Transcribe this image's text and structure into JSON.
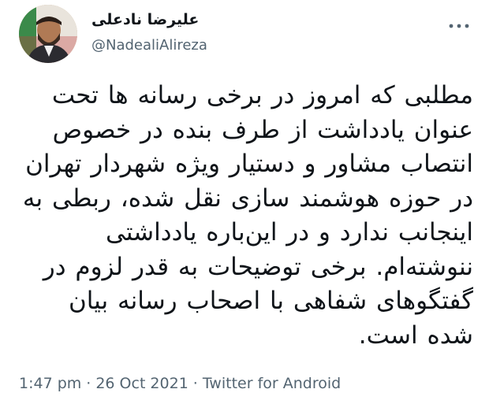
{
  "author": {
    "display_name": "علیرضا نادعلی",
    "handle": "@NadealiAlireza",
    "avatar_icon": "profile-photo"
  },
  "more_icon": "ellipsis-icon",
  "tweet": {
    "text": "مطلبی که امروز در برخی رسانه ها تحت عنوان یادداشت از طرف بنده در خصوص انتصاب مشاور و دستیار ویژه شهردار تهران در حوزه هوشمند سازی نقل شده، ربطی به اینجانب ندارد و در این‌باره یادداشتی ننوشته‌ام. برخی توضیحات به قدر لزوم در گفتگوهای شفاهی با اصحاب رسانه بیان شده است."
  },
  "meta": {
    "time": "1:47 pm",
    "separator": "·",
    "date": "26 Oct 2021",
    "source": "Twitter for Android"
  },
  "colors": {
    "text": "#0f1419",
    "secondary": "#536471"
  }
}
